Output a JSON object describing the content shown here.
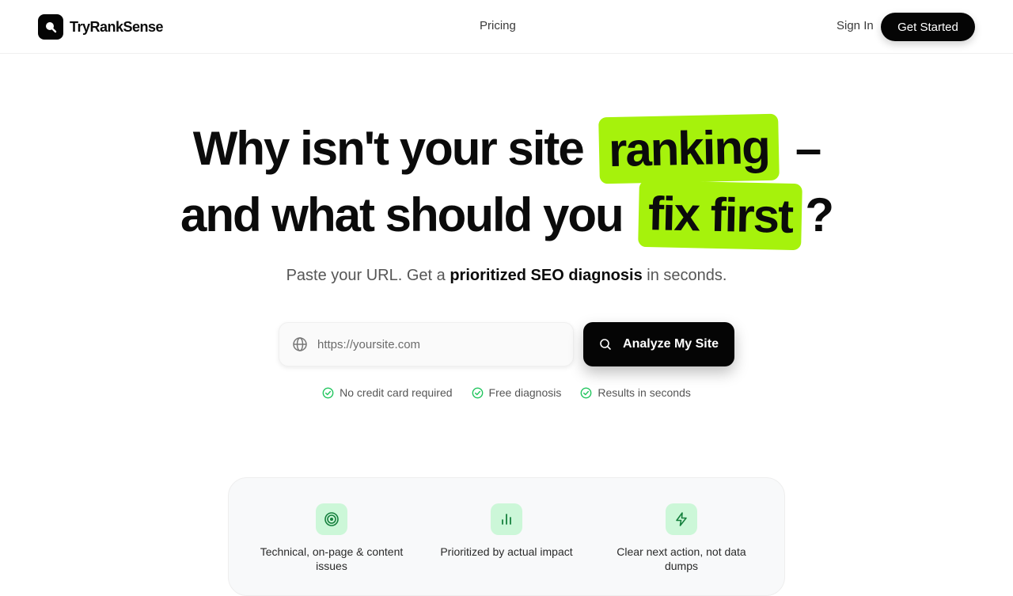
{
  "nav": {
    "brand": "TryRankSense",
    "links": [
      {
        "label": "Pricing"
      }
    ],
    "sign_in": "Sign In",
    "get_started": "Get Started"
  },
  "hero": {
    "line1_pre": "Why isn't your site",
    "line1_highlight": "ranking",
    "line1_post": "–",
    "line2_pre": "and what should you",
    "line2_highlight": "fix first",
    "line2_post": "?",
    "highlight_color": "#a6f20c",
    "subtitle_pre": "Paste your URL. Get a",
    "subtitle_bold": "prioritized SEO diagnosis",
    "subtitle_post": "in seconds."
  },
  "search": {
    "placeholder": "https://yoursite.com",
    "value": "",
    "button_label": "Analyze My Site"
  },
  "checks": [
    {
      "label": "No credit card required",
      "icon": "check-circle-icon"
    },
    {
      "label": "Free diagnosis",
      "icon": "check-circle-icon"
    },
    {
      "label": "Results in seconds",
      "icon": "check-circle-icon"
    }
  ],
  "features": [
    {
      "label": "Technical, on-page & content issues",
      "icon": "target-icon"
    },
    {
      "label": "Prioritized by actual impact",
      "icon": "bar-chart-icon"
    },
    {
      "label": "Clear next action, not data dumps",
      "icon": "lightning-icon"
    }
  ],
  "colors": {
    "accent": "#a6f20c",
    "primary": "#050505",
    "success": "#22c55e",
    "feature_icon_bg": "#ccf7d8"
  }
}
